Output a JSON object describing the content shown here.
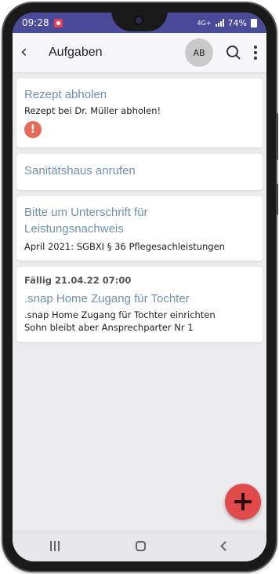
{
  "status_bar": {
    "time": "09:28",
    "network": "4G+",
    "battery": "74%"
  },
  "app_bar": {
    "title": "Aufgaben",
    "avatar_initials": "AB",
    "back_icon": "chevron-left-icon",
    "search_icon": "search-icon",
    "more_icon": "more-vert-icon"
  },
  "tasks": [
    {
      "title": "Rezept abholen",
      "description": "Rezept bei Dr. Müller abholen!",
      "has_alert": true
    },
    {
      "title": "Sanitätshaus anrufen"
    },
    {
      "title_line1": "Bitte um Unterschrift für",
      "title_line2": "Leistungsnachweis",
      "description": "April 2021: SGBXI § 36 Pflegesachleistungen"
    },
    {
      "due": "Fällig 21.04.22 07:00",
      "title": ".snap Home Zugang für Tochter",
      "description_line1": ".snap Home Zugang für Tochter einrichten",
      "description_line2": "Sohn bleibt aber Ansprechparter Nr 1"
    }
  ],
  "colors": {
    "status_bar": "#4a4a9a",
    "task_title": "#6f92ab",
    "fab": "#e04a4a",
    "alert": "#e46b57"
  }
}
